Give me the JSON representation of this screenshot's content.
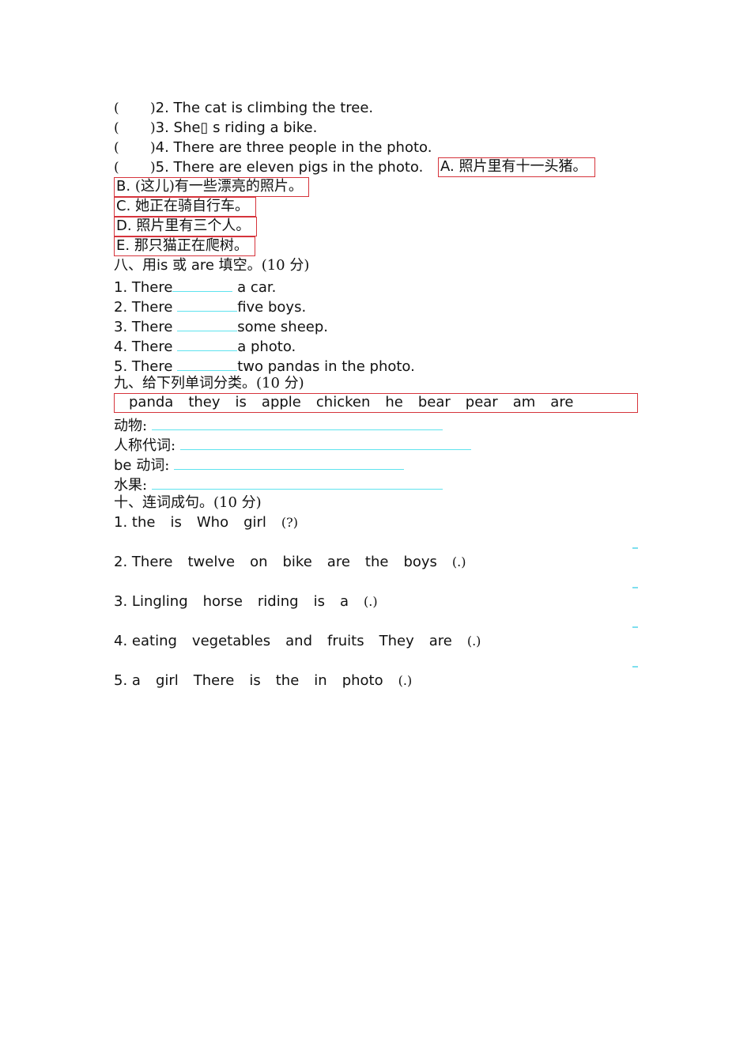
{
  "matching": {
    "questions": [
      {
        "paren_open": "(",
        "paren_close": ")",
        "text": "2. The cat is climbing the tree."
      },
      {
        "paren_open": "(",
        "paren_close": ")",
        "text": "3. She▯ s riding a bike."
      },
      {
        "paren_open": "(",
        "paren_close": ")",
        "text": "4. There are three people in the photo."
      },
      {
        "paren_open": "(",
        "paren_close": ")",
        "text": "5. There are eleven pigs in the photo."
      }
    ],
    "options": [
      {
        "letter": "A.",
        "text": "照片里有十一头猪。"
      },
      {
        "letter": "B.",
        "text": "(这儿)有一些漂亮的照片。"
      },
      {
        "letter": "C.",
        "text": "她正在骑自行车。"
      },
      {
        "letter": "D.",
        "text": "照片里有三个人。"
      },
      {
        "letter": "E.",
        "text": "那只猫正在爬树。"
      }
    ]
  },
  "section8": {
    "heading_prefix": "八、用",
    "heading_is": "is",
    "heading_or": " 或 ",
    "heading_are": "are",
    "heading_suffix": " 填空。",
    "heading_score": "(10 分)",
    "items": [
      {
        "prefix": "1. There",
        "rest": " a car."
      },
      {
        "prefix": "2. There ",
        "rest": "five boys."
      },
      {
        "prefix": "3. There ",
        "rest": "some sheep."
      },
      {
        "prefix": "4. There ",
        "rest": "a photo."
      },
      {
        "prefix": "5. There ",
        "rest": "two pandas in the photo."
      }
    ]
  },
  "section9": {
    "heading": "九、给下列单词分类。",
    "heading_score": "(10 分)",
    "words": [
      "panda",
      "they",
      "is",
      "apple",
      "chicken",
      "he",
      "bear",
      "pear",
      "am",
      "are"
    ],
    "categories": [
      {
        "label_en": "",
        "label_cn": "动物:"
      },
      {
        "label_en": "",
        "label_cn": "人称代词:"
      },
      {
        "label_en": "be",
        "label_cn": " 动词:"
      },
      {
        "label_en": "",
        "label_cn": "水果:"
      }
    ]
  },
  "section10": {
    "heading": "十、连词成句。",
    "heading_score": "(10 分)",
    "items": [
      {
        "number": "1.",
        "words": [
          "the",
          "is",
          "Who",
          "girl"
        ],
        "punct": "(?)"
      },
      {
        "number": "2.",
        "words": [
          "There",
          "twelve",
          "on",
          "bike",
          "are",
          "the",
          "boys"
        ],
        "punct": "(.)"
      },
      {
        "number": "3.",
        "words": [
          "Lingling",
          "horse",
          "riding",
          "is",
          "a"
        ],
        "punct": "(.)"
      },
      {
        "number": "4.",
        "words": [
          "eating",
          "vegetables",
          "and",
          "fruits",
          "They",
          "are"
        ],
        "punct": "(.)"
      },
      {
        "number": "5.",
        "words": [
          "a",
          "girl",
          "There",
          "is",
          "the",
          "in",
          "photo"
        ],
        "punct": "(.)"
      }
    ]
  },
  "colors": {
    "box_border": "#d6343c",
    "blank_line": "#5ee3ee"
  }
}
